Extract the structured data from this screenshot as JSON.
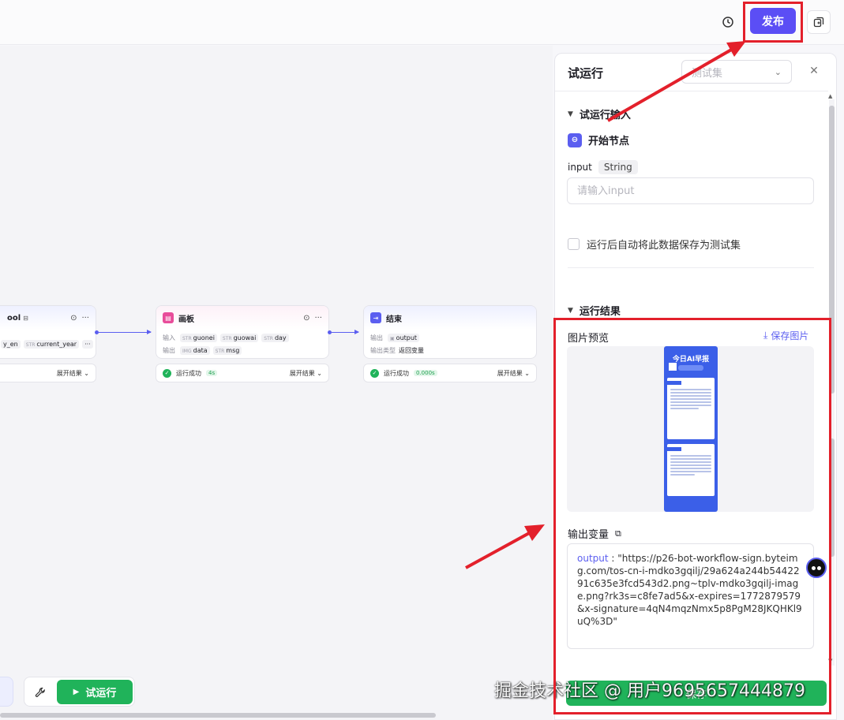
{
  "topbar": {
    "publish_label": "发布"
  },
  "canvas": {
    "node_tool": {
      "title": "ool",
      "input_tags": [
        "y_en",
        "current_year"
      ],
      "more": "···",
      "expand_label": "展开结果"
    },
    "node_board": {
      "title": "画板",
      "input_label": "输入",
      "output_label": "输出",
      "input_tags": [
        {
          "type": "STR",
          "name": "guonei"
        },
        {
          "type": "STR",
          "name": "guowai"
        },
        {
          "type": "STR",
          "name": "day"
        }
      ],
      "output_tags": [
        {
          "type": "IMG",
          "name": "data"
        },
        {
          "type": "STR",
          "name": "msg"
        }
      ],
      "status": "运行成功",
      "time": "4s",
      "expand_label": "展开结果"
    },
    "node_end": {
      "title": "结束",
      "output_label": "输出",
      "output_tag": "output",
      "output_type_label": "输出类型",
      "output_type_value": "返回变量",
      "status": "运行成功",
      "time": "0.000s",
      "expand_label": "展开结果"
    },
    "run_button_label": "试运行"
  },
  "panel": {
    "title": "试运行",
    "testset_placeholder": "测试集",
    "input_section_title": "试运行输入",
    "start_node_label": "开始节点",
    "field_name": "input",
    "field_type": "String",
    "input_placeholder": "请输入input",
    "save_checkbox_label": "运行后自动将此数据保存为测试集",
    "result_section_title": "运行结果",
    "image_preview_label": "图片预览",
    "save_image_label": "保存图片",
    "poster_title": "今日AI早报",
    "output_var_label": "输出变量",
    "output_key": "output",
    "output_value": "\"https://p26-bot-workflow-sign.byteimg.com/tos-cn-i-mdko3gqilj/29a624a244b5442291c635e3fcd543d2.png~tplv-mdko3gqilj-image.png?rk3s=c8fe7ad5&x-expires=1772879579&x-signature=4qN4mqzNmx5p8PgM28JKQHKl9uQ%3D\"",
    "save_button_label": "保存"
  },
  "watermark": "掘金技术社区 @ 用户9695657444879",
  "colors": {
    "accent": "#5b4ef5",
    "success": "#20b35a",
    "annotation": "#e3202b"
  }
}
